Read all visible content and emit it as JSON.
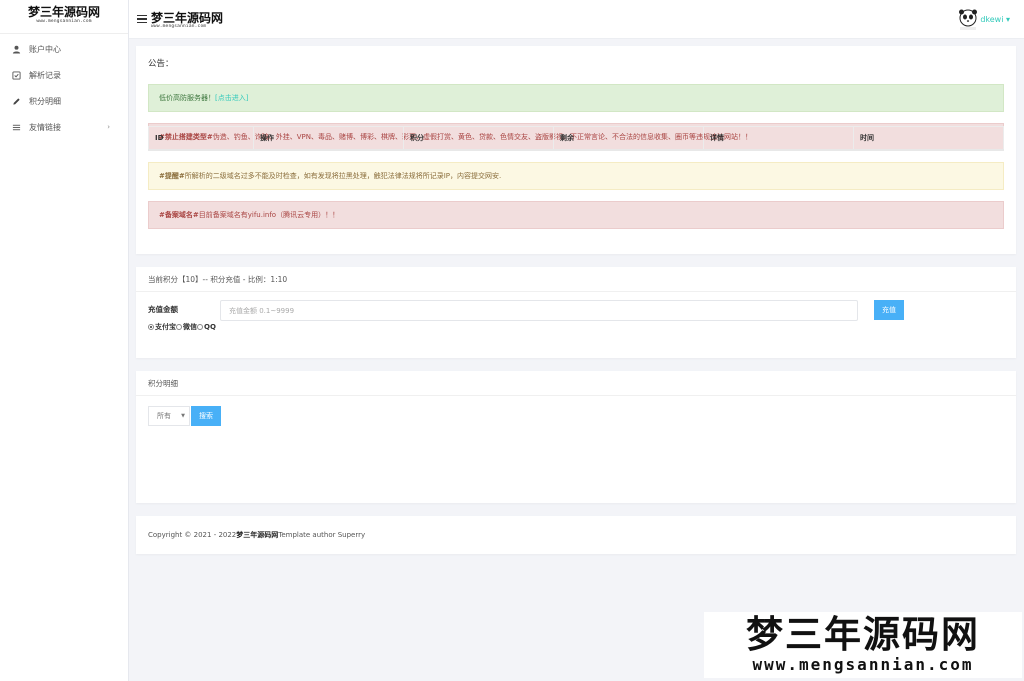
{
  "brand": {
    "name": "梦三年源码网",
    "url": "www.mengsannian.com"
  },
  "sidebar": {
    "items": [
      {
        "label": "账户中心",
        "icon": "user-icon"
      },
      {
        "label": "解析记录",
        "icon": "record-icon"
      },
      {
        "label": "积分明细",
        "icon": "pencil-icon"
      },
      {
        "label": "友情链接",
        "icon": "list-icon",
        "chevron": "›"
      }
    ]
  },
  "header": {
    "username": "dkewi",
    "caret": "▾"
  },
  "notice": {
    "title": "公告：",
    "alerts": [
      {
        "type": "success",
        "text": "低价高防服务器！",
        "link": "[点击进入]"
      },
      {
        "type": "danger",
        "bold": "#禁止搭建类型#",
        "text": " 伪造、钓鱼、诈骗、外挂、VPN、毒品、赌博、博彩、棋牌、彩票、虚假打赏、黄色、贷款、色情交友、盗版影视、不正常言论、不合法的信息收集、圈币等违规违法网站！！"
      },
      {
        "type": "warning",
        "bold": "#提醒#",
        "text": " 所解析的二级域名过多不能及时检查，如有发现将拉黑处理，触犯法律法规将所记录IP，内容提交网安."
      },
      {
        "type": "danger",
        "bold": "#备案域名#",
        "text": " 目前备案域名有yifu.info（腾讯云专用）！！"
      }
    ]
  },
  "recharge": {
    "header": "当前积分【10】-- 积分充值 - 比例：1:10",
    "label": "充值金额",
    "placeholder": "充值金额 0.1~9999",
    "button": "充值",
    "payments": [
      {
        "label": "支付宝",
        "selected": true
      },
      {
        "label": "微信",
        "selected": false
      },
      {
        "label": "QQ",
        "selected": false
      }
    ]
  },
  "points": {
    "title": "积分明细",
    "filter_value": "所有",
    "search_button": "搜索",
    "columns": [
      "ID",
      "操作",
      "积分",
      "剩余",
      "详情",
      "时间"
    ]
  },
  "footer": {
    "prefix": "Copyright © 2021 - 2022 ",
    "site": "梦三年源码网",
    "suffix": " Template author Superry"
  },
  "watermark": {
    "main": "梦三年源码网",
    "url": "www.mengsannian.com"
  },
  "colors": {
    "accent": "#33cabb",
    "button": "#48b0f7"
  }
}
